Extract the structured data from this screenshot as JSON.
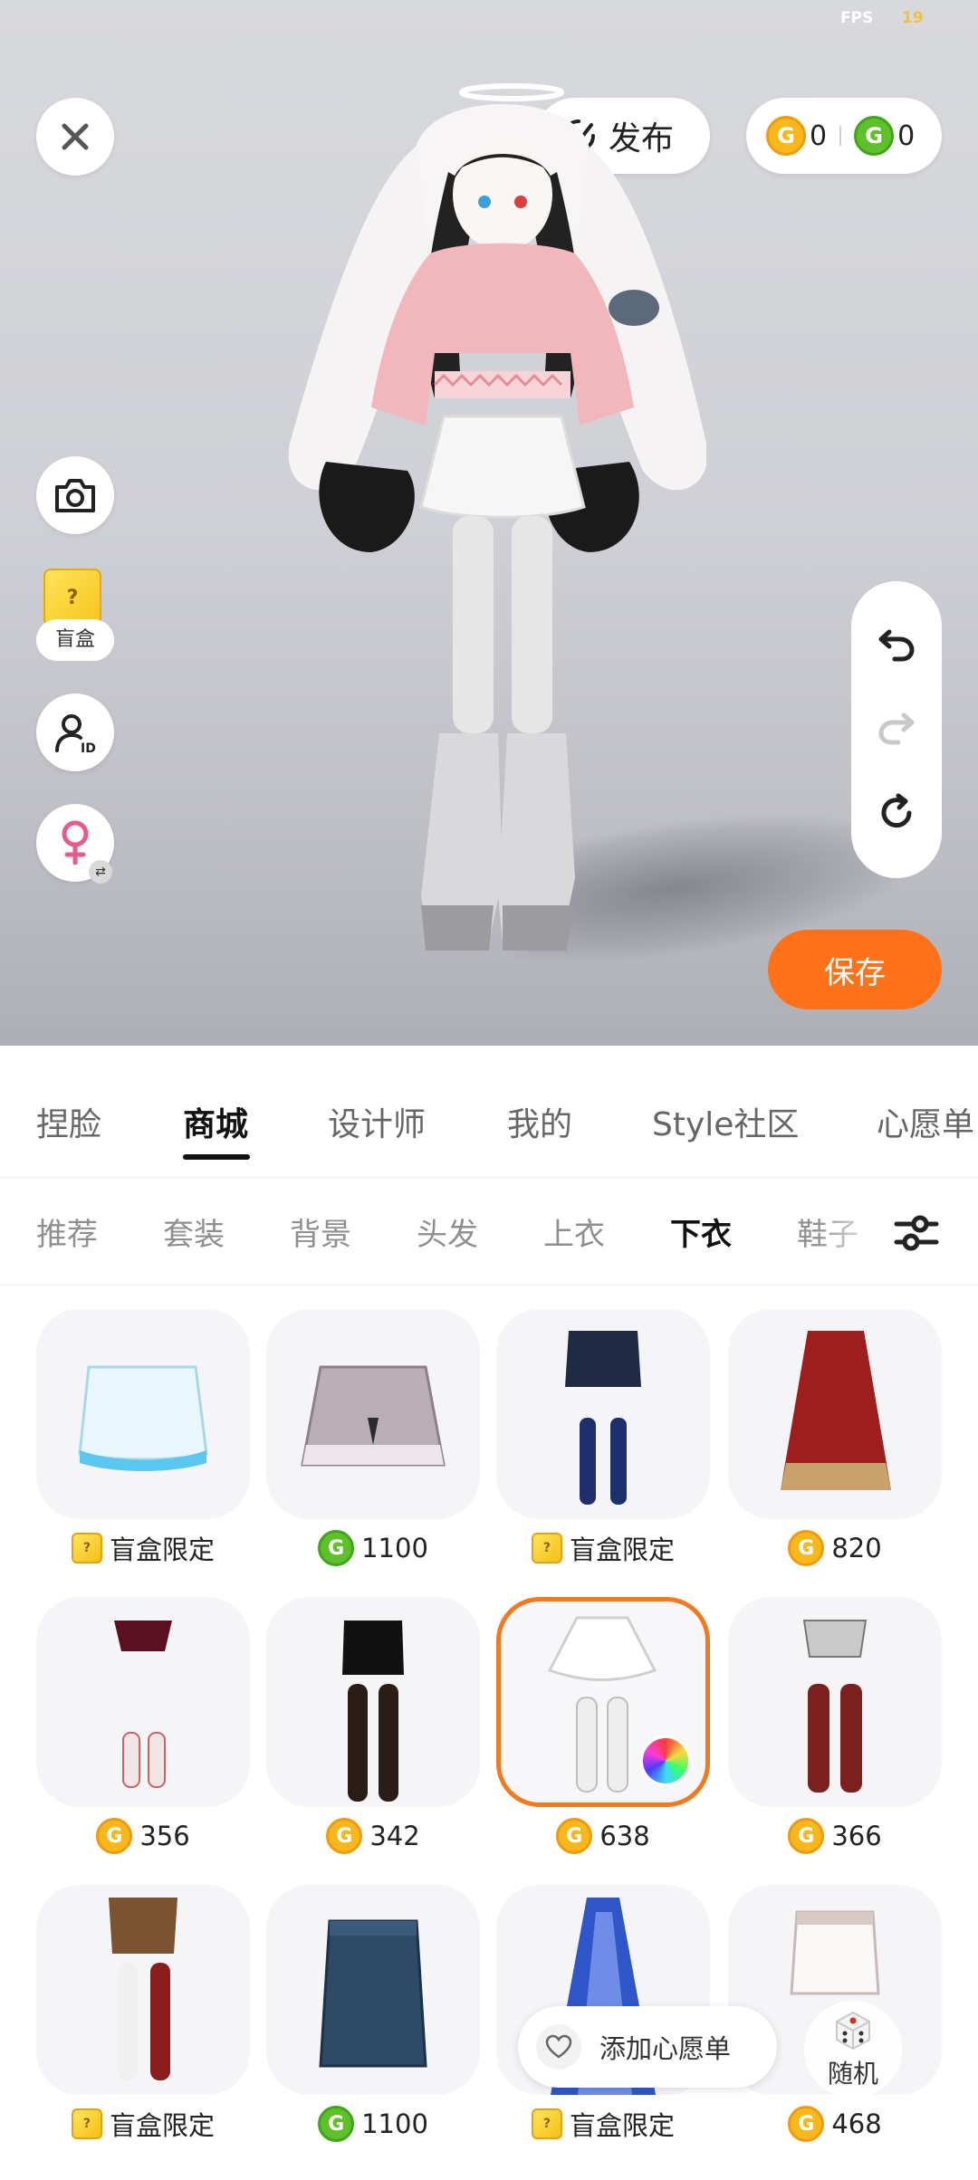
{
  "status": {
    "fps_label": "FPS",
    "fps_value": "19"
  },
  "header": {
    "publish_label": "发布",
    "gold_amount": "0",
    "green_amount": "0",
    "coin_glyph": "G"
  },
  "side_tools": {
    "blindbox_label": "盲盒",
    "blindbox_glyph": "?",
    "gender_swap_glyph": "⇄"
  },
  "actions": {
    "save_label": "保存"
  },
  "main_tabs": [
    {
      "label": "捏脸"
    },
    {
      "label": "商城"
    },
    {
      "label": "设计师"
    },
    {
      "label": "我的"
    },
    {
      "label": "Style社区"
    },
    {
      "label": "心愿单"
    }
  ],
  "sub_tabs": [
    {
      "label": "推荐"
    },
    {
      "label": "套装"
    },
    {
      "label": "背景"
    },
    {
      "label": "头发"
    },
    {
      "label": "上衣"
    },
    {
      "label": "下衣"
    },
    {
      "label": "鞋子"
    }
  ],
  "items": [
    {
      "price_type": "blindbox",
      "price": "盲盒限定",
      "icon": "shorts-blue-icon"
    },
    {
      "price_type": "green",
      "price": "1100",
      "icon": "skirt-pattern-icon"
    },
    {
      "price_type": "blindbox",
      "price": "盲盒限定",
      "icon": "shorts-black-leg-wraps-icon"
    },
    {
      "price_type": "gold",
      "price": "820",
      "icon": "skirt-red-long-icon"
    },
    {
      "price_type": "gold",
      "price": "356",
      "icon": "shorts-maroon-socks-icon"
    },
    {
      "price_type": "gold",
      "price": "342",
      "icon": "skirt-black-tights-icon"
    },
    {
      "price_type": "gold",
      "price": "638",
      "icon": "skirt-white-socks-icon",
      "selected": true
    },
    {
      "price_type": "gold",
      "price": "366",
      "icon": "shorts-grey-socks-icon"
    },
    {
      "price_type": "blindbox",
      "price": "盲盒限定",
      "icon": "shorts-brown-socks-icon"
    },
    {
      "price_type": "green",
      "price": "1100",
      "icon": "skirt-denim-icon"
    },
    {
      "price_type": "blindbox",
      "price": "盲盒限定",
      "icon": "dress-blue-icon"
    },
    {
      "price_type": "gold",
      "price": "468",
      "icon": "shorts-white-icon"
    }
  ],
  "floating": {
    "wishlist_label": "添加心愿单",
    "random_label": "随机"
  },
  "colors": {
    "accent": "#ff7217",
    "selected_border": "#f17a1f",
    "gold": "#f7b81c",
    "green": "#5ec12a"
  }
}
